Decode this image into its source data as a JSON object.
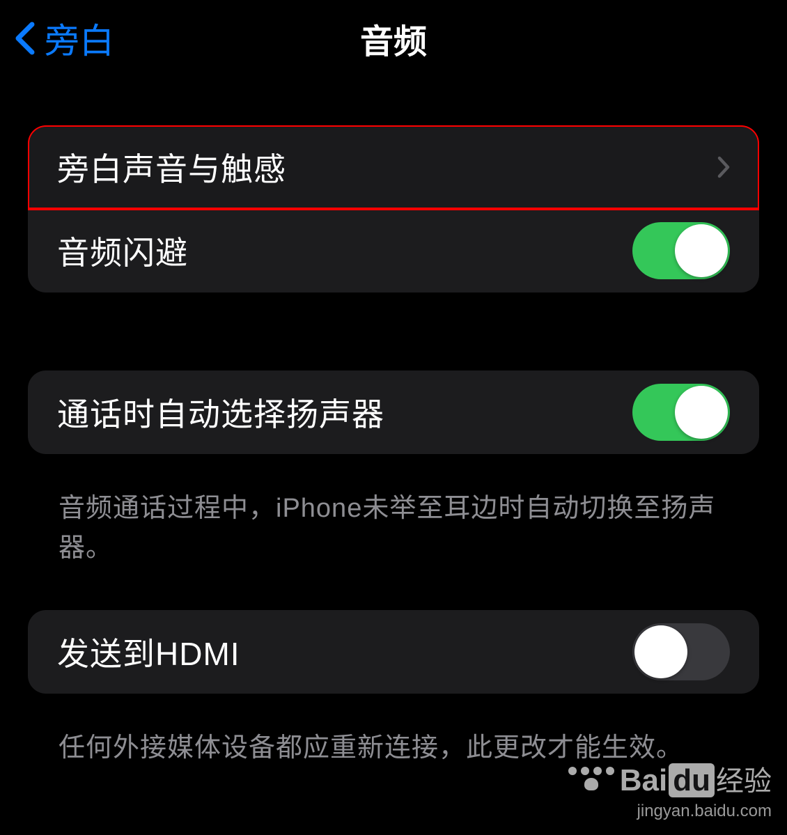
{
  "header": {
    "back_label": "旁白",
    "title": "音频"
  },
  "rows": {
    "sounds_haptics": "旁白声音与触感",
    "audio_ducking": "音频闪避",
    "auto_speaker": "通话时自动选择扬声器",
    "auto_speaker_footer": "音频通话过程中，iPhone未举至耳边时自动切换至扬声器。",
    "send_hdmi": "发送到HDMI",
    "send_hdmi_footer": "任何外接媒体设备都应重新连接，此更改才能生效。"
  },
  "toggles": {
    "audio_ducking": true,
    "auto_speaker": true,
    "send_hdmi": false
  },
  "watermark": {
    "brand_prefix": "Bai",
    "brand_mid": "du",
    "brand_suffix": "经验",
    "url": "jingyan.baidu.com"
  }
}
